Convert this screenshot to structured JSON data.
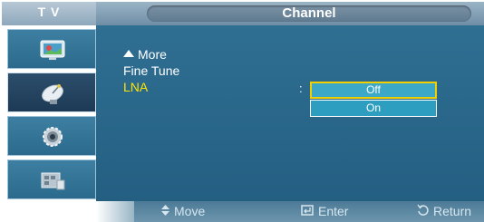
{
  "header": {
    "source_label": "T V",
    "title": "Channel"
  },
  "sidebar": {
    "items": [
      {
        "name": "picture",
        "icon": "picture-icon"
      },
      {
        "name": "channel",
        "icon": "satellite-dish-icon",
        "active": true
      },
      {
        "name": "setup",
        "icon": "gear-icon"
      },
      {
        "name": "input",
        "icon": "input-icon"
      }
    ]
  },
  "menu": {
    "more_label": "More",
    "fine_tune_label": "Fine Tune",
    "lna_label": "LNA",
    "separator": ":",
    "lna_options": [
      "Off",
      "On"
    ],
    "lna_selected": "Off"
  },
  "footer": {
    "move_label": "Move",
    "enter_label": "Enter",
    "return_label": "Return"
  },
  "colors": {
    "accent_yellow": "#ffe400",
    "panel_blue": "#2f6f92",
    "option_blue": "#3ba8c8"
  }
}
